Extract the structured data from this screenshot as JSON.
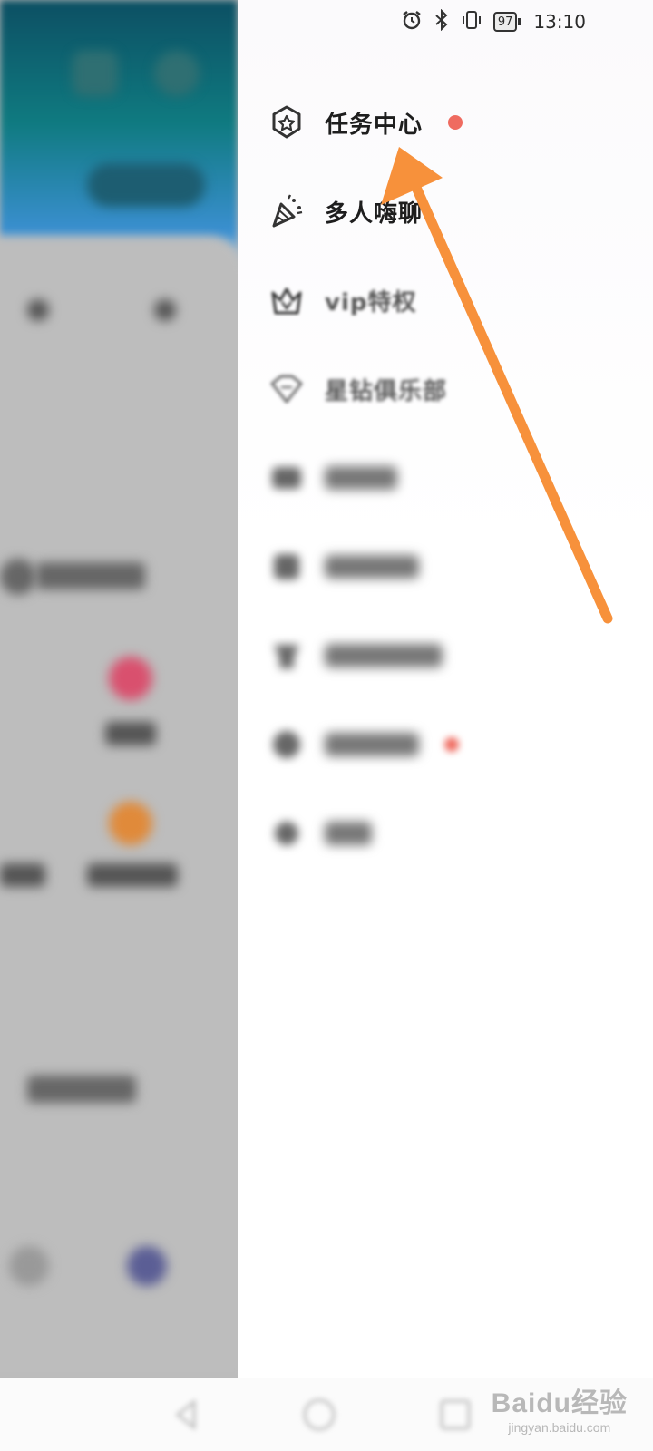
{
  "status_bar": {
    "icons": [
      "alarm-icon",
      "bluetooth-icon",
      "vibrate-icon"
    ],
    "battery": "97",
    "time": "13:10"
  },
  "drawer": {
    "items": [
      {
        "label": "任务中心",
        "icon": "star-badge-icon",
        "badge": true
      },
      {
        "label": "多人嗨聊",
        "icon": "party-popper-icon",
        "badge": false
      },
      {
        "label": "vip特权",
        "icon": "crown-icon",
        "badge": false
      },
      {
        "label": "星钻俱乐部",
        "icon": "diamond-icon",
        "badge": false
      }
    ]
  },
  "annotation": {
    "color": "#f7913b"
  },
  "watermark": {
    "brand": "Baidu经验",
    "url": "jingyan.baidu.com"
  }
}
